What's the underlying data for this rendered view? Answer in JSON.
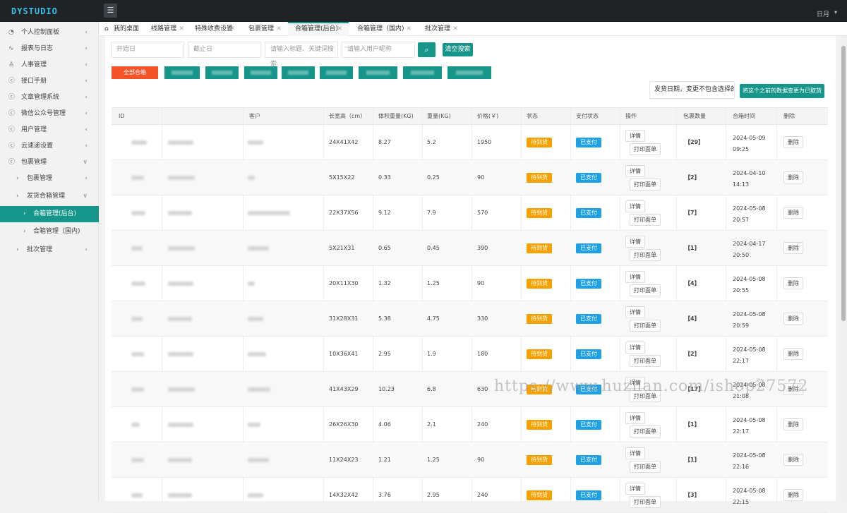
{
  "header": {
    "logo": "DYSTUDIO",
    "menu_icon": "☰",
    "user": "日月",
    "caret": "▾"
  },
  "sidebar": [
    {
      "icon": "◔",
      "label": "个人控制面板",
      "arrow": "‹",
      "level": 0
    },
    {
      "icon": "∿",
      "label": "报表与日志",
      "arrow": "‹",
      "level": 0
    },
    {
      "icon": "♙",
      "label": "人事管理",
      "arrow": "‹",
      "level": 0
    },
    {
      "icon": "ⓒ",
      "label": "接口手册",
      "arrow": "‹",
      "level": 0
    },
    {
      "icon": "ⓒ",
      "label": "文章管理系统",
      "arrow": "‹",
      "level": 0
    },
    {
      "icon": "ⓒ",
      "label": "微信公众号管理",
      "arrow": "‹",
      "level": 0
    },
    {
      "icon": "ⓒ",
      "label": "用户管理",
      "arrow": "‹",
      "level": 0
    },
    {
      "icon": "ⓒ",
      "label": "云速递设置",
      "arrow": "‹",
      "level": 0
    },
    {
      "icon": "ⓒ",
      "label": "包裹管理",
      "arrow": "∨",
      "level": 0
    },
    {
      "icon": "›",
      "label": "包裹管理",
      "arrow": "‹",
      "level": 1
    },
    {
      "icon": "›",
      "label": "发货合箱管理",
      "arrow": "∨",
      "level": 1
    },
    {
      "icon": "›",
      "label": "合箱管理(后台)",
      "arrow": "",
      "level": 2,
      "active": true
    },
    {
      "icon": "›",
      "label": "合箱管理（国内)",
      "arrow": "",
      "level": 2
    },
    {
      "icon": "›",
      "label": "批次管理",
      "arrow": "‹",
      "level": 1
    }
  ],
  "tabs": [
    {
      "label": "我的桌面",
      "icon": "⌂",
      "closable": false
    },
    {
      "label": "线路管理",
      "closable": true
    },
    {
      "label": "特殊收费设置",
      "closable": true
    },
    {
      "label": "包裹管理",
      "closable": true
    },
    {
      "label": "合箱管理(后台)",
      "closable": true,
      "active": true
    },
    {
      "label": "合箱管理（国内)",
      "closable": true
    },
    {
      "label": "批次管理",
      "closable": true
    }
  ],
  "filters": {
    "start_date": "开始日",
    "end_date": "截止日",
    "keyword": "请输入标题、关键词搜索",
    "nickname": "请输入用户昵称",
    "search_icon": "⌕",
    "clear_label": "清空搜索"
  },
  "chips": [
    "全部合箱"
  ],
  "note_text": "发货日期，变更不包含选择的",
  "bulk_button": "将这个之前的数据变更为已取货",
  "columns": [
    "ID",
    "",
    "客户",
    "长宽高（cm）",
    "体积重量(KG)",
    "重量(KG)",
    "价格(￥)",
    "状态",
    "支付状态",
    "操作",
    "包裹数量",
    "合箱时间",
    "删除"
  ],
  "row_labels": {
    "status": "待到货",
    "pay": "已支付",
    "detail": "详情",
    "print": "打印面单",
    "delete": "删除"
  },
  "rows": [
    {
      "dims": "24X41X42",
      "vol": "8.27",
      "weight": "5.2",
      "price": "1950",
      "count": "【29】",
      "time": "2024-05-09 09:25"
    },
    {
      "dims": "5X15X22",
      "vol": "0.33",
      "weight": "0.25",
      "price": "90",
      "count": "【2】",
      "time": "2024-04-10 14:13"
    },
    {
      "dims": "22X37X56",
      "vol": "9.12",
      "weight": "7.9",
      "price": "570",
      "count": "【7】",
      "time": "2024-05-08 20:57"
    },
    {
      "dims": "5X21X31",
      "vol": "0.65",
      "weight": "0.45",
      "price": "390",
      "count": "【1】",
      "time": "2024-04-17 20:50"
    },
    {
      "dims": "20X11X30",
      "vol": "1.32",
      "weight": "1.25",
      "price": "90",
      "count": "【4】",
      "time": "2024-05-08 20:55"
    },
    {
      "dims": "31X28X31",
      "vol": "5.38",
      "weight": "4.75",
      "price": "330",
      "count": "【4】",
      "time": "2024-05-08 20:59"
    },
    {
      "dims": "10X36X41",
      "vol": "2.95",
      "weight": "1.9",
      "price": "180",
      "count": "【2】",
      "time": "2024-05-08 22:17"
    },
    {
      "dims": "41X43X29",
      "vol": "10.23",
      "weight": "6.8",
      "price": "630",
      "count": "【17】",
      "time": "2024-05-08 21:08"
    },
    {
      "dims": "26X26X30",
      "vol": "4.06",
      "weight": "2.1",
      "price": "240",
      "count": "【1】",
      "time": "2024-05-08 22:17"
    },
    {
      "dims": "11X24X23",
      "vol": "1.21",
      "weight": "1.25",
      "price": "90",
      "count": "【1】",
      "time": "2024-05-08 22:16"
    },
    {
      "dims": "14X32X42",
      "vol": "3.76",
      "weight": "2.95",
      "price": "240",
      "count": "【3】",
      "time": "2024-05-08 22:15"
    }
  ],
  "watermark": "https://www.huzhan.com/ishop27572"
}
